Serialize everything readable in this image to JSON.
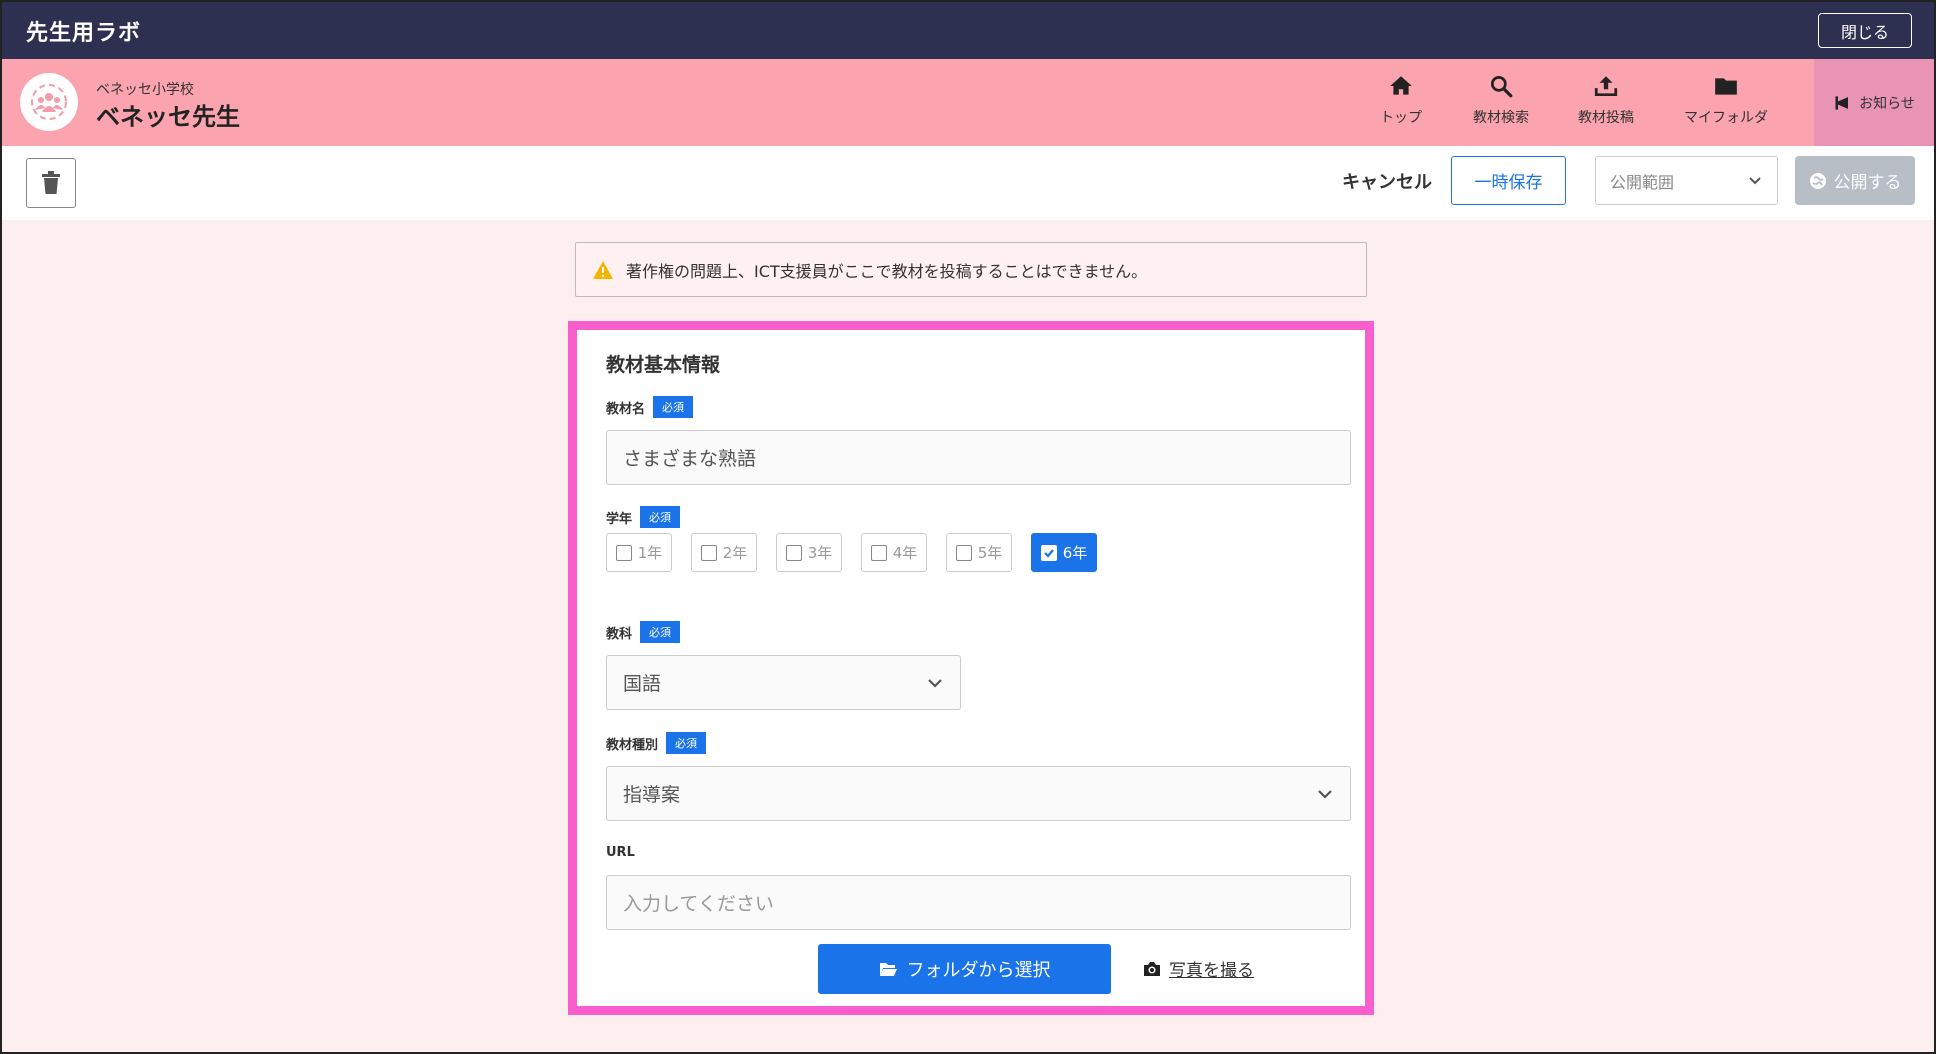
{
  "topbar": {
    "app_title": "先生用ラボ",
    "close_label": "閉じる"
  },
  "header": {
    "school_name": "ベネッセ小学校",
    "user_name": "ベネッセ先生",
    "nav": [
      {
        "label": "トップ",
        "icon": "home-icon"
      },
      {
        "label": "教材検索",
        "icon": "search-icon"
      },
      {
        "label": "教材投稿",
        "icon": "upload-icon"
      },
      {
        "label": "マイフォルダ",
        "icon": "folder-icon"
      }
    ],
    "notice_label": "お知らせ"
  },
  "toolbar": {
    "cancel_label": "キャンセル",
    "save_label": "一時保存",
    "scope_placeholder": "公開範囲",
    "publish_label": "公開する"
  },
  "warning": {
    "text": "著作権の問題上、ICT支援員がここで教材を投稿することはできません。"
  },
  "form": {
    "section_title": "教材基本情報",
    "required_badge": "必須",
    "name": {
      "label": "教材名",
      "value": "さまざまな熟語"
    },
    "grade": {
      "label": "学年",
      "options": [
        {
          "label": "1年",
          "checked": false
        },
        {
          "label": "2年",
          "checked": false
        },
        {
          "label": "3年",
          "checked": false
        },
        {
          "label": "4年",
          "checked": false
        },
        {
          "label": "5年",
          "checked": false
        },
        {
          "label": "6年",
          "checked": true
        }
      ]
    },
    "subject": {
      "label": "教科",
      "value": "国語"
    },
    "type": {
      "label": "教材種別",
      "value": "指導案"
    },
    "url": {
      "label": "URL",
      "placeholder": "入力してください"
    },
    "folder_button_label": "フォルダから選択",
    "photo_link_label": "写真を撮る"
  },
  "colors": {
    "topbar": "#2e3051",
    "header": "#fba3ae",
    "notice": "#e994b3",
    "accent": "#1a73e8",
    "card_border": "#f85fcc",
    "background": "#fdeeef"
  }
}
